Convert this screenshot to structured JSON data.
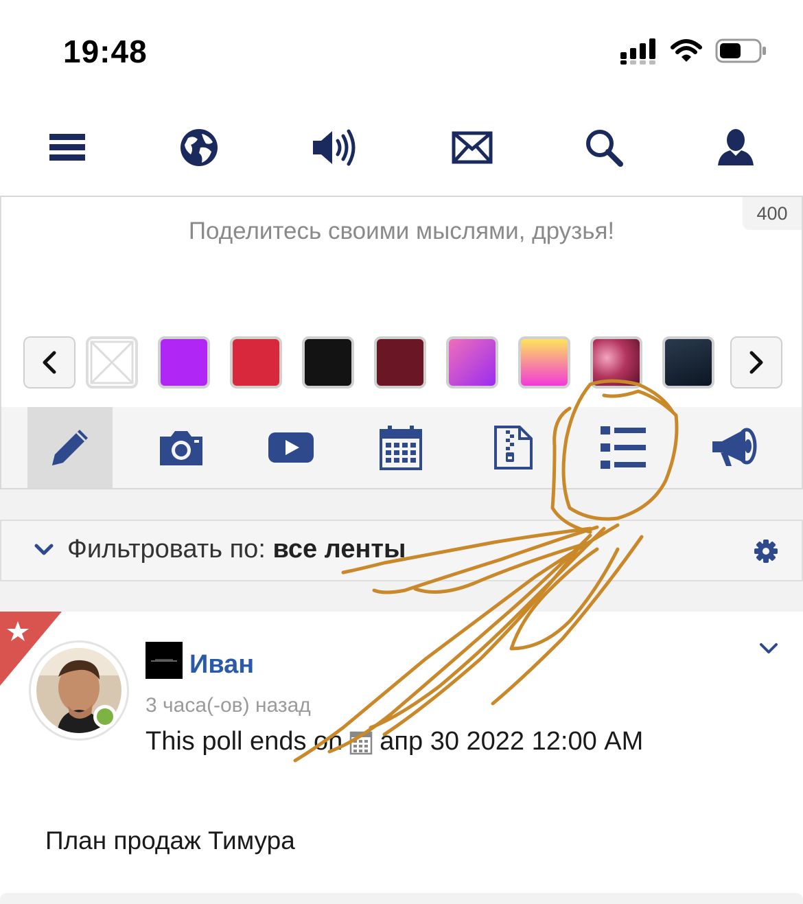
{
  "status_bar": {
    "time": "19:48",
    "icons": [
      "signal-icon",
      "wifi-icon",
      "battery-icon"
    ]
  },
  "nav": {
    "items": [
      {
        "name": "menu",
        "icon": "hamburger-icon"
      },
      {
        "name": "globe",
        "icon": "globe-icon"
      },
      {
        "name": "speaker",
        "icon": "speaker-icon"
      },
      {
        "name": "mail",
        "icon": "mail-icon"
      },
      {
        "name": "search",
        "icon": "search-icon"
      },
      {
        "name": "profile",
        "icon": "user-icon"
      }
    ],
    "color": "#1b2a5c"
  },
  "composer": {
    "placeholder": "Поделитесь своими мыслями, друзья!",
    "char_limit": "400",
    "backgrounds": [
      "none",
      "#b026f5",
      "#d7283c",
      "#131313",
      "#6b1624",
      "gradient-pink-purple",
      "gradient-yellow-magenta",
      "image-flowers",
      "image-night-sky"
    ],
    "tools": [
      "pencil-icon",
      "camera-icon",
      "video-icon",
      "calendar-icon",
      "file-zip-icon",
      "list-icon",
      "megaphone-icon"
    ],
    "active_tool": "pencil-icon"
  },
  "filter": {
    "label": "Фильтровать по: ",
    "value": "все ленты"
  },
  "post": {
    "author": "Иван",
    "time": "3 часа(-ов) назад",
    "poll_text": "This poll ends on",
    "poll_date": "апр 30 2022 12:00 AM",
    "title": "План продаж Тимура",
    "accent": "#d9534f",
    "online_color": "#7cb342"
  },
  "annotation_color": "#c9892a"
}
